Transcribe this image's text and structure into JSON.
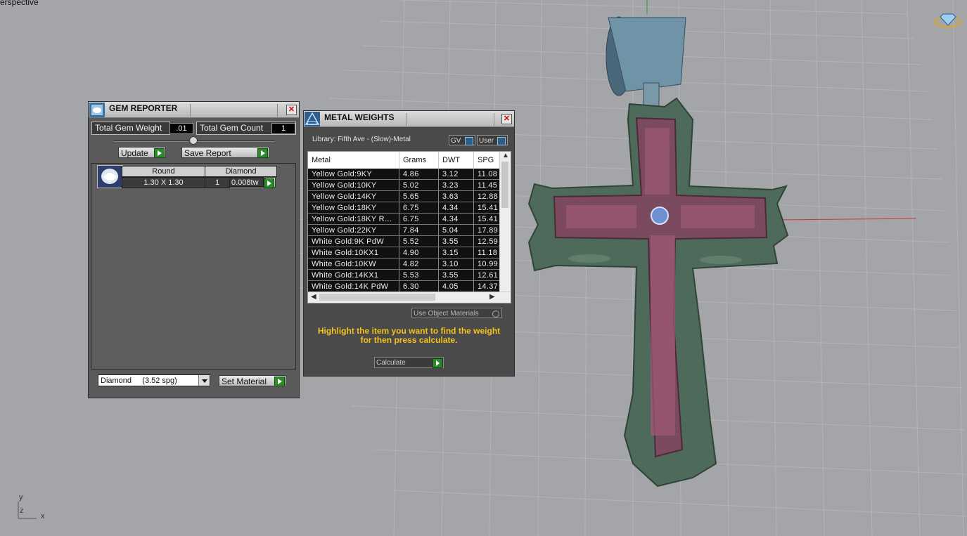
{
  "viewport": {
    "label": "erspective",
    "axes": {
      "y": "y",
      "z": "z",
      "x": "x"
    }
  },
  "gem_reporter": {
    "title": "GEM REPORTER",
    "total_weight_label": "Total Gem Weight",
    "total_weight_value": ".01",
    "total_count_label": "Total Gem Count",
    "total_count_value": "1",
    "update_label": "Update",
    "save_report_label": "Save Report",
    "gem": {
      "shape": "Round",
      "material": "Diamond",
      "size": "1.30 X 1.30",
      "qty": "1",
      "weight": "0.008tw"
    },
    "material_select": "Diamond     (3.52 spg)",
    "set_material_label": "Set Material"
  },
  "metal_weights": {
    "title": "METAL WEIGHTS",
    "library": "Library: Fifth Ave - (Slow)-Metal",
    "toggle_gv": "GV",
    "toggle_user": "User",
    "columns": [
      "Metal",
      "Grams",
      "DWT",
      "SPG"
    ],
    "rows": [
      [
        "Yellow Gold:9KY",
        "4.86",
        "3.12",
        "11.08"
      ],
      [
        "Yellow Gold:10KY",
        "5.02",
        "3.23",
        "11.45"
      ],
      [
        "Yellow Gold:14KY",
        "5.65",
        "3.63",
        "12.88"
      ],
      [
        "Yellow Gold:18KY",
        "6.75",
        "4.34",
        "15.41"
      ],
      [
        "Yellow Gold:18KY R...",
        "6.75",
        "4.34",
        "15.41"
      ],
      [
        "Yellow Gold:22KY",
        "7.84",
        "5.04",
        "17.89"
      ],
      [
        "White Gold:9K PdW",
        "5.52",
        "3.55",
        "12.59"
      ],
      [
        "White Gold:10KX1",
        "4.90",
        "3.15",
        "11.18"
      ],
      [
        "White Gold:10KW",
        "4.82",
        "3.10",
        "10.99"
      ],
      [
        "White Gold:14KX1",
        "5.53",
        "3.55",
        "12.61"
      ],
      [
        "White Gold:14K PdW",
        "6.30",
        "4.05",
        "14.37"
      ]
    ],
    "use_object_materials": "Use Object Materials",
    "hint_line1": "Highlight the item you want to find the weight",
    "hint_line2": "for then press calculate.",
    "calculate_label": "Calculate"
  }
}
